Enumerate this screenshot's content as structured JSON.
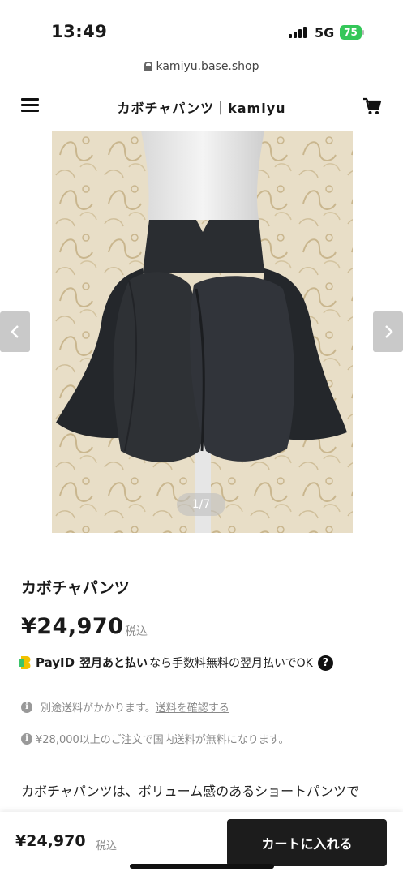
{
  "status_bar": {
    "time": "13:49",
    "network": "5G",
    "battery": "75",
    "icons": [
      "signal-icon",
      "battery-icon"
    ]
  },
  "browser": {
    "url": "kamiyu.base.shop",
    "icon": "lock-icon"
  },
  "header": {
    "title": "カボチャパンツ｜kamiyu",
    "menu_icon": "menu-icon",
    "cart_icon": "cart-icon"
  },
  "carousel": {
    "indicator": "1/7",
    "prev_icon": "chevron-left-icon",
    "next_icon": "chevron-right-icon"
  },
  "product": {
    "name": "カボチャパンツ",
    "price": "¥24,970",
    "tax_label": "税込"
  },
  "payid": {
    "label": "PayID",
    "brand": "翌月あと払い",
    "text": "なら手数料無料の翌月払いでOK",
    "help": "?"
  },
  "notices": {
    "shipping_text": "別途送料がかかります。",
    "shipping_link": "送料を確認する",
    "free_shipping": "¥28,000以上のご注文で国内送料が無料になります。"
  },
  "description": {
    "text": "カボチャパンツは、ボリューム感のあるショートパンツで"
  },
  "bottom_bar": {
    "price": "¥24,970",
    "tax_label": "税込",
    "cart_button": "カートに入れる"
  },
  "colors": {
    "button": "#1c1c1c",
    "battery": "#34c759",
    "payid_accent": "#f2c200",
    "text_muted": "#888888"
  }
}
